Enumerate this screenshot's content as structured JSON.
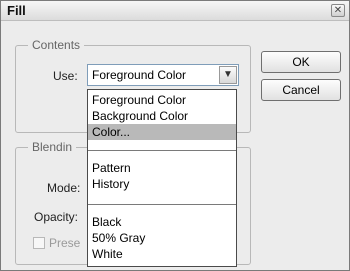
{
  "window": {
    "title": "Fill",
    "close_glyph": "✕"
  },
  "contents": {
    "legend": "Contents",
    "use_label": "Use:",
    "use_value": "Foreground Color"
  },
  "dropdown": {
    "options": [
      "Foreground Color",
      "Background Color",
      "Color...",
      "Pattern",
      "History",
      "Black",
      "50% Gray",
      "White"
    ],
    "selected": "Color..."
  },
  "blending": {
    "legend": "Blendin",
    "mode_label": "Mode:",
    "opacity_label": "Opacity:",
    "preserve_label": "Prese"
  },
  "buttons": {
    "ok": "OK",
    "cancel": "Cancel"
  },
  "icons": {
    "close": "close-icon",
    "dropdown_arrow": "chevron-down-icon"
  }
}
